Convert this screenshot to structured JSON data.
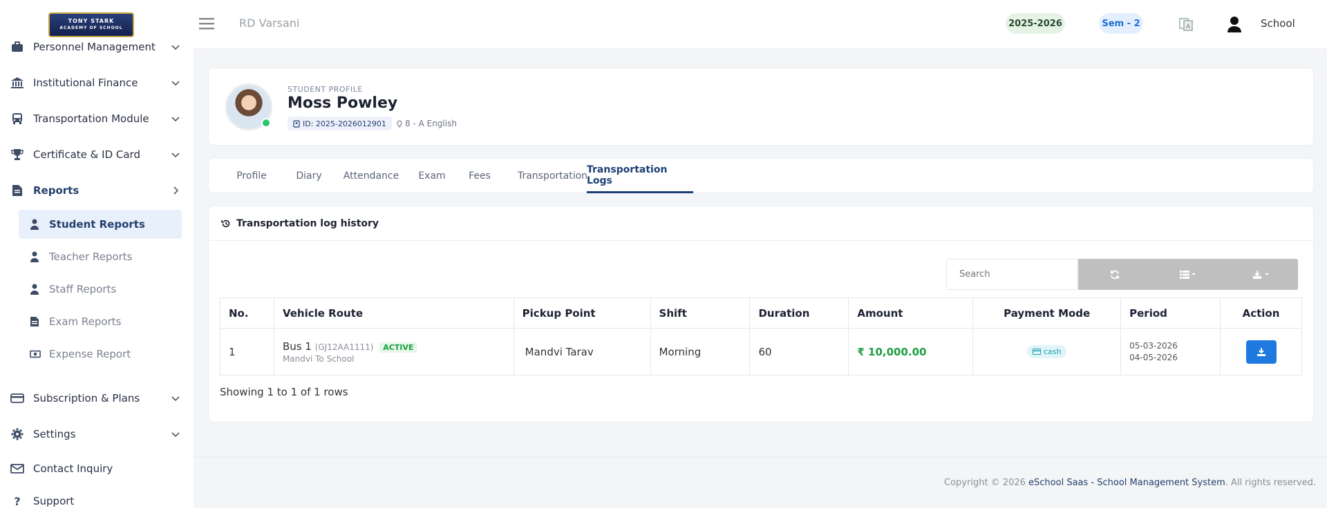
{
  "logo": {
    "line1": "TONY STARK",
    "line2": "ACADEMY OF SCHOOL"
  },
  "sidebar": {
    "items": [
      {
        "label": "Personnel Management",
        "icon": "briefcase-icon"
      },
      {
        "label": "Institutional Finance",
        "icon": "bank-icon"
      },
      {
        "label": "Transportation Module",
        "icon": "bus-icon"
      },
      {
        "label": "Certificate & ID Card",
        "icon": "trophy-icon"
      },
      {
        "label": "Reports",
        "icon": "document-icon"
      },
      {
        "label": "Subscription & Plans",
        "icon": "credit-card-icon"
      },
      {
        "label": "Settings",
        "icon": "gear-icon"
      },
      {
        "label": "Contact Inquiry",
        "icon": "envelope-icon"
      },
      {
        "label": "Support",
        "icon": "question-icon"
      }
    ],
    "report_subitems": [
      {
        "label": "Student Reports",
        "icon": "user-icon"
      },
      {
        "label": "Teacher Reports",
        "icon": "user-icon"
      },
      {
        "label": "Staff Reports",
        "icon": "user-icon"
      },
      {
        "label": "Exam Reports",
        "icon": "document-icon"
      },
      {
        "label": "Expense Report",
        "icon": "money-icon"
      }
    ]
  },
  "topbar": {
    "school_name": "RD Varsani",
    "session": "2025-2026",
    "semester": "Sem - 2",
    "user_label": "School"
  },
  "profile": {
    "kicker": "STUDENT PROFILE",
    "name": "Moss Powley",
    "id": "ID: 2025-2026012901",
    "class": "8 - A English"
  },
  "tabs": [
    "Profile",
    "Diary",
    "Attendance",
    "Exam",
    "Fees",
    "Transportation",
    "Transportation Logs"
  ],
  "log": {
    "title": "Transportation log history",
    "search_placeholder": "Search",
    "columns": [
      "No.",
      "Vehicle Route",
      "Pickup Point",
      "Shift",
      "Duration",
      "Amount",
      "Payment Mode",
      "Period",
      "Action"
    ],
    "rows": [
      {
        "no": "1",
        "vehicle": "Bus 1",
        "reg": "(GJ12AA1111)",
        "status": "ACTIVE",
        "route": "Mandvi To School",
        "pickup": "Mandvi Tarav",
        "shift": "Morning",
        "duration": "60",
        "amount": "₹ 10,000.00",
        "payment_mode": "cash",
        "period_start": "05-03-2026",
        "period_end": "04-05-2026"
      }
    ],
    "rows_info": "Showing 1 to 1 of 1 rows"
  },
  "footer": {
    "prefix": "Copyright © 2026",
    "brand": "eSchool Saas - School Management System",
    "suffix": ". All rights reserved."
  },
  "colors": {
    "accent": "#1d3f75",
    "success": "#1c9e3f",
    "primary_button": "#1f7ae0"
  }
}
